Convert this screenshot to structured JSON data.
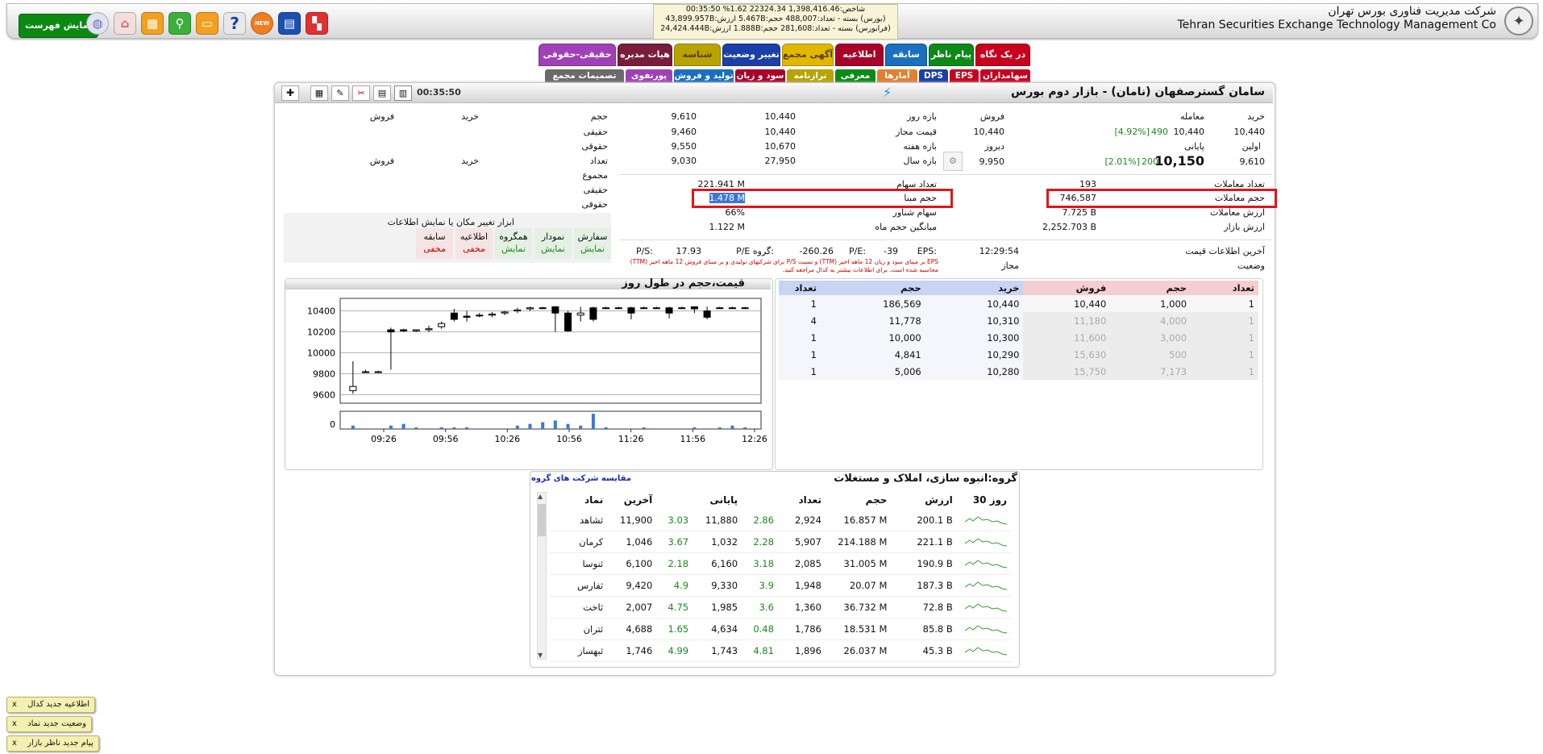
{
  "header": {
    "show_list": "نمایش فهرست",
    "company_fa": "شرکت مدیریت فناوری بورس تهران",
    "company_en": "Tehran Securities Exchange Technology Management Co",
    "index_line1": "شاخص:1,398,416.46 22324.34 1.62% 00:35:50",
    "index_line2": "(بورس) بسته - تعداد:488,007 حجم:5.467B ارزش:43,899.957B",
    "index_line3": "(فرابورس) بسته - تعداد:281,608 حجم:1.888B ارزش:24,424.444B",
    "new_badge": "NEW"
  },
  "tabs_row1": [
    "در یک نگاه",
    "پیام ناظر",
    "سابقه",
    "اطلاعیه",
    "آگهی مجمع",
    "تغییر وضعیت",
    "شناسه",
    "هیات مدیره",
    "حقیقی-حقوقی"
  ],
  "tabs_row2": [
    "سهامداران",
    "EPS",
    "DPS",
    "آمارها",
    "معرفی",
    "ترازنامه",
    "سود و زیان",
    "تولید و فروش",
    "پورتفوی",
    "تصمیمات مجمع"
  ],
  "title": {
    "symbol_title": "سامان گسترصفهان (نامان) - بازار دوم بورس",
    "time": "00:35:50"
  },
  "price_block": {
    "buy_label": "خرید",
    "trade_label": "معامله",
    "sell_label": "فروش",
    "buy": "10,440",
    "trade": "10,440",
    "trade_vol": "490",
    "trade_pct": "[4.92%]",
    "sell": "10,440",
    "first_label": "اولین",
    "close_label": "پایانی",
    "yesterday_label": "دیروز",
    "first": "9,610",
    "close": "10,150",
    "close_vol": "200",
    "close_pct": "[2.01%]",
    "yesterday": "9,950"
  },
  "ranges": {
    "day_label": "بازه روز",
    "allowed_label": "قیمت مجاز",
    "week_label": "بازه هفته",
    "year_label": "بازه سال",
    "day_hi": "10,440",
    "day_lo": "9,610",
    "allowed_hi": "10,440",
    "allowed_lo": "9,460",
    "week_hi": "10,670",
    "week_lo": "9,550",
    "year_hi": "27,950",
    "year_lo": "9,030"
  },
  "stats_right": {
    "trades_count_label": "تعداد معاملات",
    "trades_count": "193",
    "trades_vol_label": "حجم معاملات",
    "trades_vol": "746,587",
    "trades_value_label": "ارزش معاملات",
    "trades_value": "7.725 B",
    "market_value_label": "ارزش بازار",
    "market_value": "2,252.703 B",
    "last_info_label": "آخرین اطلاعات قیمت",
    "last_info": "12:29:54",
    "status_label": "وضعیت",
    "status": "مجاز"
  },
  "stats_mid": {
    "shares_label": "تعداد سهام",
    "shares": "221.941 M",
    "base_vol_label": "حجم مبنا",
    "base_vol": "1.478 M",
    "float_label": "سهام شناور",
    "float": "66%",
    "monthly_label": "میانگین حجم ماه",
    "monthly": "1.122 M"
  },
  "eps_row": {
    "eps_label": "EPS:",
    "eps": "-39",
    "pe_label": "P/E:",
    "pe": "-260.26",
    "gpe_label": "P/E گروه:",
    "gpe": "17.93",
    "ps_label": "P/S:",
    "note": "EPS بر مبنای سود و زیان 12 ماهه اخیر (TTM) و نسبت P/S برای شرکتهای تولیدی و بر مبنای فروش 12 ماهه اخیر (TTM) محاسبه شده است. برای اطلاعات بیشتر به کدال مراجعه کنید."
  },
  "client": {
    "h_vol": "حجم",
    "h_buy": "خرید",
    "h_sell": "فروش",
    "real": "حقیقی",
    "legal": "حقوقی",
    "h_count": "تعداد",
    "total": "مجموع"
  },
  "tools": {
    "label": "ابزار تغییر مکان یا نمایش اطلاعات",
    "items": [
      {
        "name": "سفارش",
        "state": "نمایش"
      },
      {
        "name": "نمودار",
        "state": "نمایش"
      },
      {
        "name": "همگروه",
        "state": "نمایش"
      },
      {
        "name": "اطلاعیه",
        "state": "مخفی"
      },
      {
        "name": "سابقه",
        "state": "مخفی"
      }
    ]
  },
  "orderbook": {
    "headers": [
      "تعداد",
      "حجم",
      "خرید",
      "فروش",
      "حجم",
      "تعداد"
    ],
    "rows": [
      [
        "1",
        "186,569",
        "10,440",
        "10,440",
        "1,000",
        "1"
      ],
      [
        "4",
        "11,778",
        "10,310",
        "11,180",
        "4,000",
        "1"
      ],
      [
        "1",
        "10,000",
        "10,300",
        "11,600",
        "3,000",
        "1"
      ],
      [
        "1",
        "4,841",
        "10,290",
        "15,630",
        "500",
        "1"
      ],
      [
        "1",
        "5,006",
        "10,280",
        "15,750",
        "7,173",
        "1"
      ]
    ]
  },
  "chart_data": {
    "type": "candlestick",
    "title": "قیمت،حجم در طول روز",
    "y_ticks": [
      10400,
      10200,
      10000,
      9800,
      9600
    ],
    "vol_tick": "0",
    "x_ticks": [
      "09:26",
      "09:56",
      "10:26",
      "10:56",
      "11:26",
      "11:56",
      "12:26"
    ],
    "ylim": [
      9520,
      10520
    ],
    "candles": [
      [
        9640,
        9920,
        9610,
        9680
      ],
      [
        9820,
        9840,
        9820,
        9820
      ],
      [
        9820,
        9830,
        9810,
        9820
      ],
      [
        10220,
        10240,
        9840,
        10200
      ],
      [
        10220,
        10230,
        10200,
        10210
      ],
      [
        10210,
        10220,
        10200,
        10220
      ],
      [
        10220,
        10260,
        10200,
        10230
      ],
      [
        10250,
        10300,
        10230,
        10280
      ],
      [
        10380,
        10420,
        10300,
        10320
      ],
      [
        10350,
        10400,
        10300,
        10340
      ],
      [
        10360,
        10380,
        10340,
        10360
      ],
      [
        10360,
        10390,
        10340,
        10370
      ],
      [
        10380,
        10400,
        10360,
        10390
      ],
      [
        10400,
        10430,
        10380,
        10410
      ],
      [
        10420,
        10440,
        10400,
        10430
      ],
      [
        10430,
        10440,
        10420,
        10430
      ],
      [
        10440,
        10440,
        10200,
        10380
      ],
      [
        10380,
        10400,
        10200,
        10210
      ],
      [
        10360,
        10440,
        10300,
        10380
      ],
      [
        10430,
        10440,
        10300,
        10320
      ],
      [
        10430,
        10440,
        10420,
        10430
      ],
      [
        10430,
        10440,
        10420,
        10430
      ],
      [
        10430,
        10440,
        10320,
        10380
      ],
      [
        10430,
        10440,
        10420,
        10430
      ],
      [
        10430,
        10440,
        10420,
        10430
      ],
      [
        10430,
        10440,
        10330,
        10380
      ],
      [
        10430,
        10440,
        10420,
        10430
      ],
      [
        10440,
        10440,
        10380,
        10420
      ],
      [
        10400,
        10440,
        10320,
        10340
      ],
      [
        10430,
        10440,
        10420,
        10430
      ],
      [
        10430,
        10440,
        10420,
        10430
      ],
      [
        10430,
        10440,
        10420,
        10430
      ]
    ],
    "volumes": [
      2,
      0,
      0,
      2,
      3,
      1,
      0,
      1,
      1,
      1,
      0,
      0,
      0,
      2,
      3,
      4,
      5,
      3,
      2,
      9,
      1,
      0,
      0,
      1,
      0,
      0,
      0,
      1,
      0,
      1,
      2,
      1
    ]
  },
  "group": {
    "title": "گروه:انبوه سازی، املاک و مستغلات",
    "compare_link": "مقایسه شرکت های گروه",
    "headers": [
      "نماد",
      "آخرین",
      "",
      "پایانی",
      "",
      "تعداد",
      "حجم",
      "ارزش",
      "30 روز"
    ],
    "rows": [
      [
        "ثشاهد",
        "11,900",
        "3.03",
        "11,880",
        "2.86",
        "2,924",
        "16.857 M",
        "200.1 B"
      ],
      [
        "کرمان",
        "1,046",
        "3.67",
        "1,032",
        "2.28",
        "5,907",
        "214.188 M",
        "221.1 B"
      ],
      [
        "ثنوسا",
        "6,100",
        "2.18",
        "6,160",
        "3.18",
        "2,085",
        "31.005 M",
        "190.9 B"
      ],
      [
        "ثفارس",
        "9,420",
        "4.9",
        "9,330",
        "3.9",
        "1,948",
        "20.07 M",
        "187.3 B"
      ],
      [
        "ثاخت",
        "2,007",
        "4.75",
        "1,985",
        "3.6",
        "1,360",
        "36.732 M",
        "72.8 B"
      ],
      [
        "ثتران",
        "4,688",
        "1.65",
        "4,634",
        "0.48",
        "1,786",
        "18.531 M",
        "85.8 B"
      ],
      [
        "ثبهساز",
        "1,746",
        "4.99",
        "1,743",
        "4.81",
        "1,896",
        "26.037 M",
        "45.3 B"
      ]
    ]
  },
  "toasts": [
    "اطلاعیه جدید کدال",
    "وضعیت جدید نماد",
    "پیام جدید ناظر بازار"
  ],
  "colors": {
    "tab_red": "#c8001e",
    "tab_green": "#0c8a18",
    "tab_blue": "#1a6fc0",
    "tab_darkred": "#a8002a",
    "tab_yellow": "#e0b800",
    "tab_navy": "#1b3fa8",
    "tab_olive": "#b8a400",
    "tab_maroon": "#7a1c3c",
    "tab_purple": "#a040b8"
  }
}
